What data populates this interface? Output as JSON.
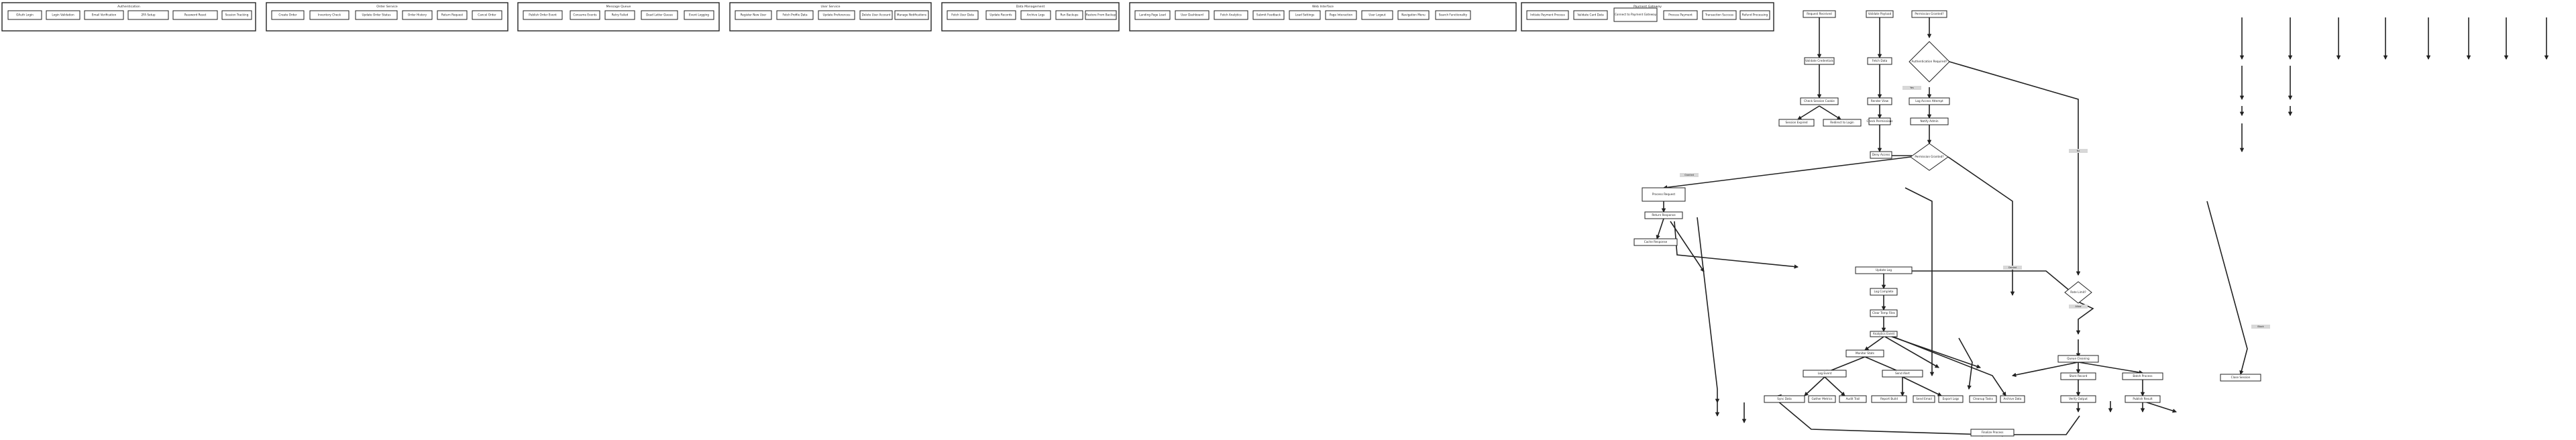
{
  "groups": [
    {
      "id": "g1",
      "title": "Authentication",
      "nodes": [
        "OAuth Login",
        "Login Validation",
        "Email Verification",
        "2FA Setup",
        "Password Reset",
        "Session Tracking"
      ]
    },
    {
      "id": "g2",
      "title": "Order Service",
      "nodes": [
        "Create Order",
        "Inventory Check",
        "Update Order Status",
        "Order History",
        "Return Request",
        "Cancel Order"
      ]
    },
    {
      "id": "g3",
      "title": "Message Queue",
      "nodes": [
        "Publish Order Event",
        "Consume Events",
        "Retry Failed",
        "Dead Letter Queue",
        "Event Logging"
      ]
    },
    {
      "id": "g4",
      "title": "User Service",
      "nodes": [
        "Register New User",
        "Fetch Profile Data",
        "Update Preferences",
        "Delete User Account",
        "Manage Notifications"
      ]
    },
    {
      "id": "g5",
      "title": "Data Management",
      "nodes": [
        "Fetch User Data",
        "Update Records",
        "Archive Logs",
        "Run Backups",
        "Restore From Backup"
      ]
    },
    {
      "id": "g6",
      "title": "Web Interface",
      "nodes": [
        "Landing Page Load",
        "User Dashboard",
        "Fetch Analytics",
        "Submit Feedback",
        "Load Settings",
        "Page Interaction",
        "User Logout",
        "Navigation Menu",
        "Search Functionality"
      ]
    },
    {
      "id": "g7",
      "title": "Payment Gateway",
      "nodes": [
        "Initiate Payment Process",
        "Validate Card Data",
        "Connect to Payment Gateway",
        "Process Payment",
        "Transaction Success",
        "Refund Processing"
      ]
    }
  ],
  "flow_nodes": [
    "Request Received",
    "Validate Credentials",
    "Check Session Cookie",
    "Session Expired",
    "Redirect to Login",
    "Validate Payload",
    "Fetch Data",
    "Render View",
    "Check Permissions",
    "Permission Granted?",
    "Log Access Attempt",
    "Notify Admin",
    "Deny Access",
    "Process Request",
    "Return Response",
    "Cache Response",
    "Update Log",
    "Log Complete",
    "Clear Temp Files",
    "Analytics Event",
    "Monitor Stats",
    "Log Event",
    "Send Alert",
    "Sync Data",
    "Gather Metrics",
    "Audit Trail",
    "Report Build",
    "Send Email",
    "Export Logs",
    "Cleanup Tasks",
    "Archive Data",
    "Finalize Process",
    "Queue Cleaning",
    "Store Record",
    "Batch Process",
    "Verify Output",
    "Publish Result",
    "Close Session"
  ],
  "decisions": [
    "Authentication Required?",
    "Permission Granted?",
    "Rate Limit?"
  ],
  "edge_labels": [
    "Yes",
    "No",
    "Granted",
    "Denied",
    "Allow",
    "Block"
  ]
}
